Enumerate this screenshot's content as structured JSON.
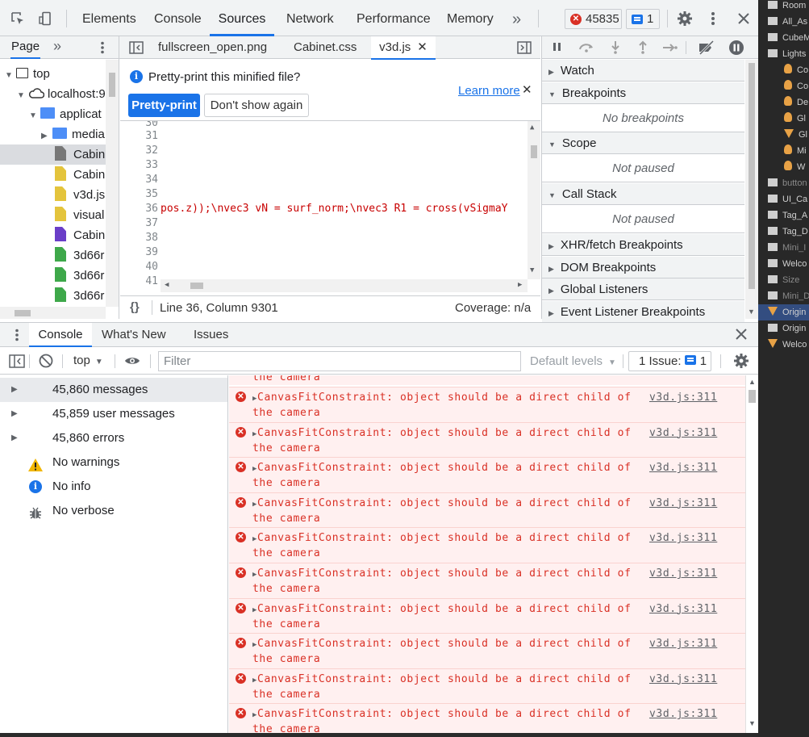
{
  "toolbar": {
    "tabs": [
      "Elements",
      "Console",
      "Sources",
      "Network",
      "Performance",
      "Memory"
    ],
    "active_tab": "Sources",
    "more_tabs": "»",
    "error_count": "45835",
    "message_count": "1"
  },
  "navigator": {
    "tab": "Page",
    "more": "»",
    "items": [
      {
        "label": "top"
      },
      {
        "label": "localhost:9"
      },
      {
        "label": "applicat"
      },
      {
        "label": "media"
      },
      {
        "label": "Cabin"
      },
      {
        "label": "Cabin"
      },
      {
        "label": "v3d.js"
      },
      {
        "label": "visual"
      },
      {
        "label": "Cabin"
      },
      {
        "label": "3d66r"
      },
      {
        "label": "3d66r"
      },
      {
        "label": "3d66r"
      }
    ]
  },
  "editor": {
    "tabs": [
      "fullscreen_open.png",
      "Cabinet.css",
      "v3d.js"
    ],
    "active_tab": "v3d.js",
    "infobar": {
      "message": "Pretty-print this minified file?",
      "learn_more": "Learn more",
      "pretty_print": "Pretty-print",
      "dont_show": "Don't show again"
    },
    "line_numbers": [
      "30",
      "31",
      "32",
      "33",
      "34",
      "35",
      "36",
      "37",
      "38",
      "39",
      "40",
      "41"
    ],
    "line36_code": "pos.z));\\nvec3 vN = surf_norm;\\nvec3 R1 = cross(vSigmaY",
    "status": {
      "braces": "{}",
      "position": "Line 36, Column 9301",
      "coverage": "Coverage: n/a"
    }
  },
  "debugger": {
    "sections": [
      {
        "title": "Watch"
      },
      {
        "title": "Breakpoints",
        "body": "No breakpoints"
      },
      {
        "title": "Scope",
        "body": "Not paused"
      },
      {
        "title": "Call Stack",
        "body": "Not paused"
      },
      {
        "title": "XHR/fetch Breakpoints"
      },
      {
        "title": "DOM Breakpoints"
      },
      {
        "title": "Global Listeners"
      },
      {
        "title": "Event Listener Breakpoints"
      }
    ]
  },
  "drawer": {
    "tabs": [
      "Console",
      "What's New",
      "Issues"
    ],
    "context": "top",
    "filter_placeholder": "Filter",
    "levels": "Default levels",
    "issues_label": "1 Issue:",
    "issues_count": "1"
  },
  "console_sidebar": [
    {
      "label": "45,860 messages",
      "icon": "list-icon"
    },
    {
      "label": "45,859 user messages",
      "icon": "user-icon"
    },
    {
      "label": "45,860 errors",
      "icon": "error-icon"
    },
    {
      "label": "No warnings",
      "icon": "warning-icon"
    },
    {
      "label": "No info",
      "icon": "info-icon"
    },
    {
      "label": "No verbose",
      "icon": "bug-icon"
    }
  ],
  "console_messages": {
    "partial_top": "the camera",
    "text": "CanvasFitConstraint: object should be a direct child of the camera",
    "source": "v3d.js:311",
    "count_visible": 10
  },
  "outliner": [
    {
      "label": "Room"
    },
    {
      "label": "All_As"
    },
    {
      "label": "CubeM"
    },
    {
      "label": "Lights"
    },
    {
      "label": "Co"
    },
    {
      "label": "Co"
    },
    {
      "label": "De"
    },
    {
      "label": "Gl"
    },
    {
      "label": "Gl"
    },
    {
      "label": "Mi"
    },
    {
      "label": "W"
    },
    {
      "label": "button"
    },
    {
      "label": "UI_Ca"
    },
    {
      "label": "Tag_A"
    },
    {
      "label": "Tag_D"
    },
    {
      "label": "Mini_I"
    },
    {
      "label": "Welco"
    },
    {
      "label": "Size"
    },
    {
      "label": "Mini_D"
    },
    {
      "label": "Origin"
    },
    {
      "label": "Origin"
    },
    {
      "label": "Welco"
    }
  ],
  "colors": {
    "accent": "#1a73e8",
    "error": "#d93025",
    "error_bg": "#fff0f0"
  }
}
